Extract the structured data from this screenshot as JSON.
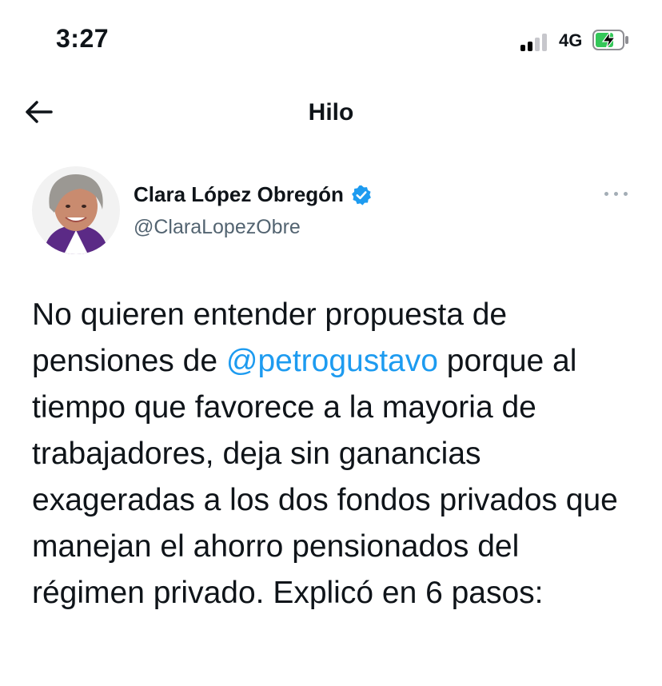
{
  "status": {
    "time": "3:27",
    "network": "4G"
  },
  "nav": {
    "title": "Hilo"
  },
  "tweet": {
    "display_name": "Clara López Obregón",
    "handle": "@ClaraLopezObre",
    "verified": true,
    "text_before": "No quieren entender propuesta de pensiones de ",
    "mention": "@petrogustavo",
    "text_after": " porque al tiempo que favorece a la mayoria de trabajadores, deja sin ganancias exageradas a los dos fondos privados que manejan el ahorro pensionados del régimen privado. Explicó en 6 pasos:"
  },
  "colors": {
    "accent": "#1d9bf0",
    "text": "#0f1419",
    "muted": "#536471",
    "battery": "#34c759"
  },
  "icons": [
    "signal-icon",
    "battery-charging-icon",
    "back-arrow-icon",
    "verified-badge-icon",
    "more-options-icon"
  ]
}
